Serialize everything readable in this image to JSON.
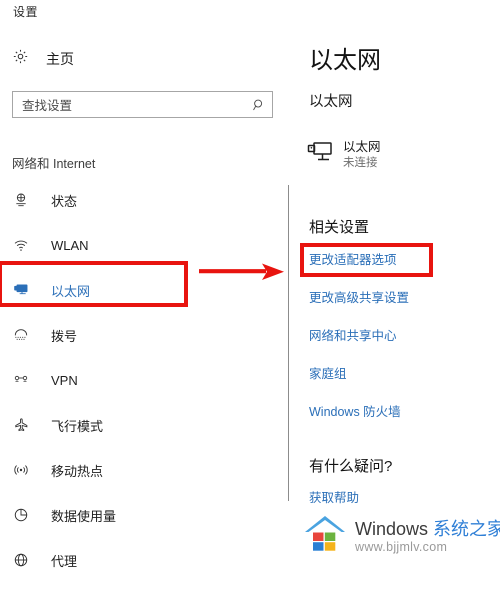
{
  "window": {
    "title": "设置"
  },
  "sidebar": {
    "home": {
      "label": "主页",
      "icon": "gear-icon"
    },
    "search": {
      "placeholder": "查找设置",
      "value": "",
      "icon": "search-icon"
    },
    "category": "网络和 Internet",
    "items": [
      {
        "label": "状态",
        "icon": "status-globe-icon",
        "selected": false
      },
      {
        "label": "WLAN",
        "icon": "wifi-icon",
        "selected": false
      },
      {
        "label": "以太网",
        "icon": "ethernet-icon",
        "selected": true
      },
      {
        "label": "拨号",
        "icon": "dialup-icon",
        "selected": false
      },
      {
        "label": "VPN",
        "icon": "vpn-icon",
        "selected": false
      },
      {
        "label": "飞行模式",
        "icon": "airplane-icon",
        "selected": false
      },
      {
        "label": "移动热点",
        "icon": "hotspot-icon",
        "selected": false
      },
      {
        "label": "数据使用量",
        "icon": "data-usage-icon",
        "selected": false
      },
      {
        "label": "代理",
        "icon": "proxy-globe-icon",
        "selected": false
      }
    ]
  },
  "content": {
    "title": "以太网",
    "subtitle": "以太网",
    "adapter": {
      "name": "以太网",
      "status": "未连接",
      "icon": "ethernet-monitor-icon"
    },
    "related": {
      "heading": "相关设置",
      "links": [
        "更改适配器选项",
        "更改高级共享设置",
        "网络和共享中心",
        "家庭组",
        "Windows 防火墙"
      ]
    },
    "questions": {
      "heading": "有什么疑问?",
      "link": "获取帮助"
    }
  },
  "watermark": {
    "brand_en": "Windows ",
    "brand_cn": "系统之家",
    "url": "www.bjjmlv.com",
    "logo": "windows-house-logo"
  },
  "annotations": {
    "highlight_color": "#e8140f",
    "boxes": [
      {
        "name": "sidebar-ethernet-highlight",
        "target": "以太网"
      },
      {
        "name": "change-adapter-options-highlight",
        "target": "更改适配器选项"
      }
    ],
    "arrow": {
      "name": "pointer-arrow",
      "direction": "right"
    }
  },
  "colors": {
    "accent_blue": "#2b6fb8",
    "annotation_red": "#e8140f",
    "divider_grey": "#8c8c8c"
  }
}
